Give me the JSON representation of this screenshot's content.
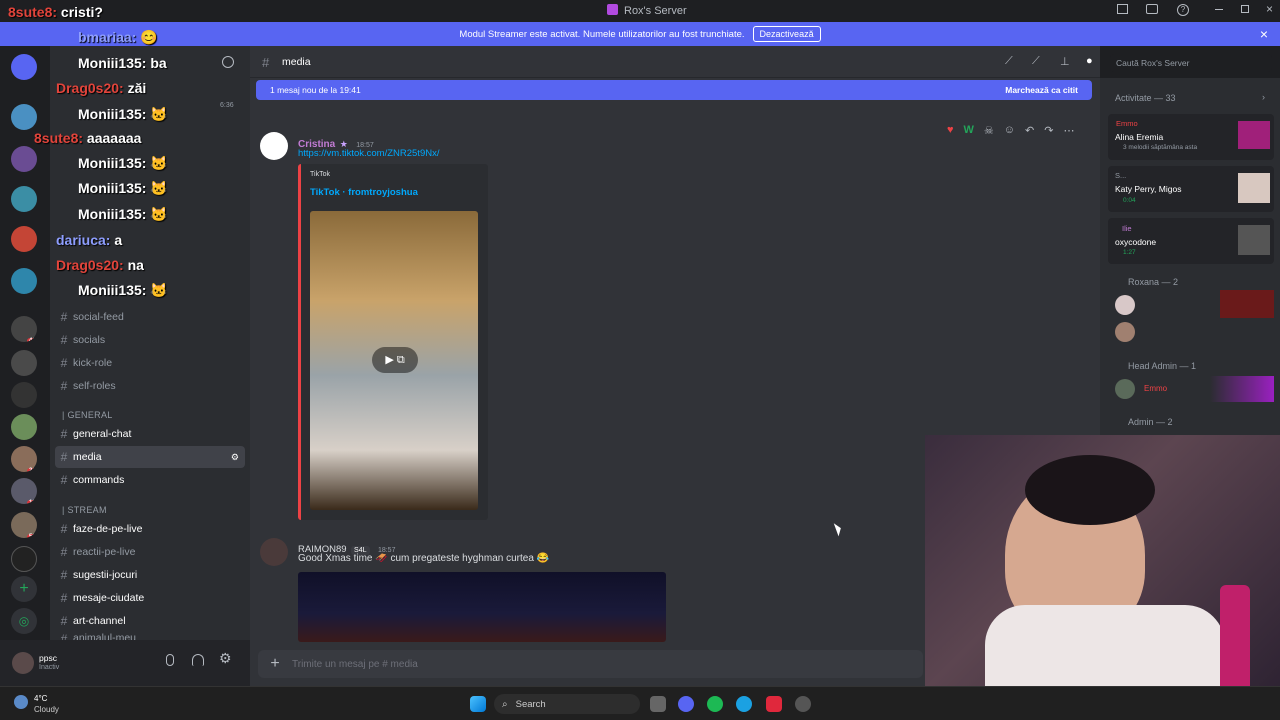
{
  "window": {
    "title": "Rox's Server"
  },
  "banner": {
    "text": "Modul Streamer este activat. Numele utilizatorilor au fost trunchiate.",
    "button": "Dezactivează"
  },
  "overlay_chat": [
    {
      "name": "8sute8:",
      "text": "cristi?",
      "color": "red"
    },
    {
      "name": "bmariaa:",
      "text": "😊",
      "color": "blue"
    },
    {
      "name": "Moniii135:",
      "text": "ba",
      "color": "green"
    },
    {
      "name": "Drag0s20:",
      "text": "zăi",
      "color": "red"
    },
    {
      "name": "Moniii135:",
      "text": "",
      "color": "green"
    },
    {
      "name": "8sute8:",
      "text": "aaaaaaa",
      "color": "red"
    },
    {
      "name": "Moniii135:",
      "text": "",
      "color": "green"
    },
    {
      "name": "Moniii135:",
      "text": "",
      "color": "green"
    },
    {
      "name": "Moniii135:",
      "text": "",
      "color": "green"
    },
    {
      "name": "dariuca:",
      "text": "a",
      "color": "blue"
    },
    {
      "name": "Drag0s20:",
      "text": "na",
      "color": "red"
    },
    {
      "name": "Moniii135:",
      "text": "",
      "color": "green"
    }
  ],
  "rail_badges": [
    "5",
    "40",
    "60",
    "465",
    "213",
    "124",
    "525"
  ],
  "sidebar": {
    "channels_top": [
      {
        "label": "social-feed",
        "count": "188"
      },
      {
        "label": "socials"
      },
      {
        "label": "kick-role"
      },
      {
        "label": "self-roles"
      }
    ],
    "cat_general": "| GENERAL",
    "channels_general": [
      {
        "label": "general-chat"
      },
      {
        "label": "media",
        "active": true
      },
      {
        "label": "commands",
        "count": "1"
      }
    ],
    "cat_stream": "| STREAM",
    "channels_stream": [
      {
        "label": "faze-de-pe-live"
      },
      {
        "label": "reactii-pe-live"
      },
      {
        "label": "sugestii-jocuri"
      },
      {
        "label": "mesaje-ciudate"
      },
      {
        "label": "art-channel"
      },
      {
        "label": "animalul-meu"
      }
    ]
  },
  "user_panel": {
    "name": "ppsc",
    "status": "Inactiv"
  },
  "header": {
    "channel": "media",
    "search_placeholder": "Caută Rox's Server"
  },
  "new_messages": {
    "text": "1 mesaj nou de la 19:41",
    "action": "Marchează ca citit"
  },
  "messages": [
    {
      "author": "Cristina",
      "time": "18:57",
      "link": "https://vm.tiktok.com/ZNR25t9Nx/",
      "embed_provider": "TikTok",
      "embed_title": "TikTok · fromtroyjoshua"
    },
    {
      "author": "RAIMON89",
      "tag": "S4L",
      "time": "18:57",
      "text": "Good Xmas time 🛷 cum pregateste hyghman curtea 😂"
    }
  ],
  "input_placeholder": "Trimite un mesaj pe # media",
  "members": {
    "activity_header": "Activitate — 33",
    "activities": [
      {
        "name": "Emmo",
        "title": "Alina Eremia",
        "sub": "3 melodii săptămâna asta"
      },
      {
        "name": "S...",
        "title": "Katy Perry, Migos",
        "sub": "0:04"
      },
      {
        "name": "Ilie",
        "title": "oxycodone",
        "sub": "1:27"
      }
    ],
    "group_roxana": "Roxana — 2",
    "group_headadmin": "Head Admin — 1",
    "headadmin_member": "Emmo",
    "group_admin": "Admin — 2"
  },
  "taskbar": {
    "weather_temp": "4°C",
    "weather_desc": "Cloudy",
    "search_label": "Search"
  },
  "colors": {
    "accent": "#5865f2",
    "red": "#da373c",
    "bg": "#313338"
  }
}
